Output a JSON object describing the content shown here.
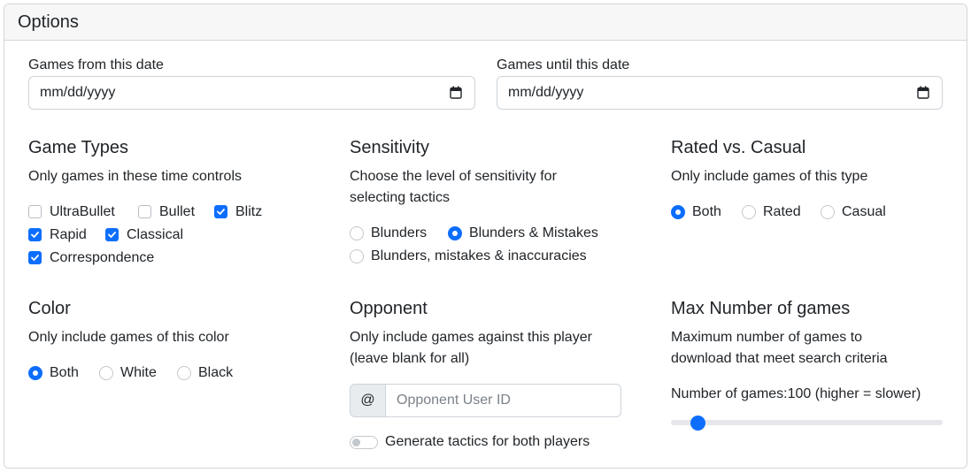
{
  "header": {
    "title": "Options"
  },
  "dates": {
    "from_label": "Games from this date",
    "from_value": "mm/dd/yyyy",
    "until_label": "Games until this date",
    "until_value": "mm/dd/yyyy"
  },
  "game_types": {
    "title": "Game Types",
    "desc": "Only games in these time controls",
    "options": [
      {
        "label": "UltraBullet",
        "checked": false
      },
      {
        "label": "Bullet",
        "checked": false
      },
      {
        "label": "Blitz",
        "checked": true
      },
      {
        "label": "Rapid",
        "checked": true
      },
      {
        "label": "Classical",
        "checked": true
      },
      {
        "label": "Correspondence",
        "checked": true
      }
    ]
  },
  "sensitivity": {
    "title": "Sensitivity",
    "desc_line1": "Choose the level of sensitivity for",
    "desc_line2": "selecting tactics",
    "options": [
      {
        "label": "Blunders",
        "selected": false
      },
      {
        "label": "Blunders & Mistakes",
        "selected": true
      },
      {
        "label": "Blunders, mistakes & inaccuracies",
        "selected": false
      }
    ]
  },
  "rated": {
    "title": "Rated vs. Casual",
    "desc": "Only include games of this type",
    "options": [
      {
        "label": "Both",
        "selected": true
      },
      {
        "label": "Rated",
        "selected": false
      },
      {
        "label": "Casual",
        "selected": false
      }
    ]
  },
  "color": {
    "title": "Color",
    "desc": "Only include games of this color",
    "options": [
      {
        "label": "Both",
        "selected": true
      },
      {
        "label": "White",
        "selected": false
      },
      {
        "label": "Black",
        "selected": false
      }
    ]
  },
  "opponent": {
    "title": "Opponent",
    "desc_line1": "Only include games against this player",
    "desc_line2": "(leave blank for all)",
    "prefix": "@",
    "placeholder": "Opponent User ID",
    "toggle_label": "Generate tactics for both players",
    "toggle_on": false
  },
  "max_games": {
    "title": "Max Number of games",
    "desc_line1": "Maximum number of games to",
    "desc_line2": "download that meet search criteria",
    "range_label": "Number of games:100 (higher = slower)",
    "value": 100
  },
  "colors": {
    "accent": "#0d6efd"
  }
}
